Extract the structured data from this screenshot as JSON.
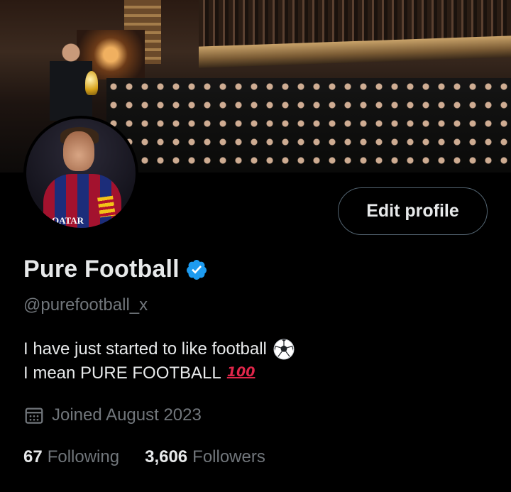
{
  "profile": {
    "display_name": "Pure Football",
    "handle": "@purefootball_x",
    "verified": true,
    "bio_line1": "I have just started to like football",
    "bio_line1_emoji": "soccer-ball-icon",
    "bio_line2": "I mean PURE FOOTBALL",
    "bio_line2_emoji": "100",
    "joined": "Joined August 2023",
    "avatar_sponsor_text": "QATAR"
  },
  "actions": {
    "edit_profile_label": "Edit profile"
  },
  "stats": {
    "following_count": "67",
    "following_label": "Following",
    "followers_count": "3,606",
    "followers_label": "Followers"
  },
  "icons": {
    "verified": "verified-badge-icon",
    "calendar": "calendar-icon"
  },
  "colors": {
    "background": "#000000",
    "primary_text": "#e7e9ea",
    "secondary_text": "#71767b",
    "verified_blue": "#1d9bf0",
    "button_border": "#536471",
    "hundred_red": "#e0264a"
  }
}
